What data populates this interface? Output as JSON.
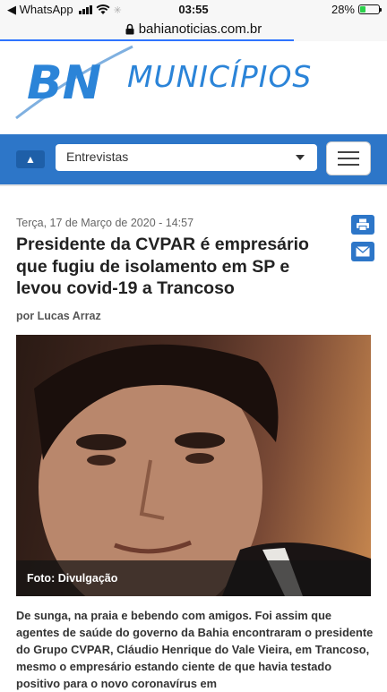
{
  "statusbar": {
    "back_app": "◀ WhatsApp",
    "time": "03:55",
    "battery_text": "28%",
    "battery_level": 0.28
  },
  "browser": {
    "url": "bahianoticias.com.br"
  },
  "site": {
    "logo_text": "BN",
    "section_title": "MUNICÍPIOS"
  },
  "nav": {
    "selected_section": "Entrevistas"
  },
  "article": {
    "date": "Terça, 17 de Março de 2020 - 14:57",
    "headline": "Presidente da CVPAR é empresário que fugiu de isolamento em SP e levou covid-19 a Trancoso",
    "byline": "por Lucas Arraz",
    "photo_caption": "Foto: Divulgação",
    "body": "De sunga, na praia e bebendo com amigos. Foi assim que agentes de saúde do governo da Bahia encontraram o presidente do Grupo CVPAR, Cláudio Henrique do Vale Vieira, em Trancoso, mesmo o empresário estando ciente de que havia testado positivo para o novo coronavírus em"
  },
  "colors": {
    "brand_blue": "#2d76c8",
    "title_blue": "#2b84d8"
  }
}
